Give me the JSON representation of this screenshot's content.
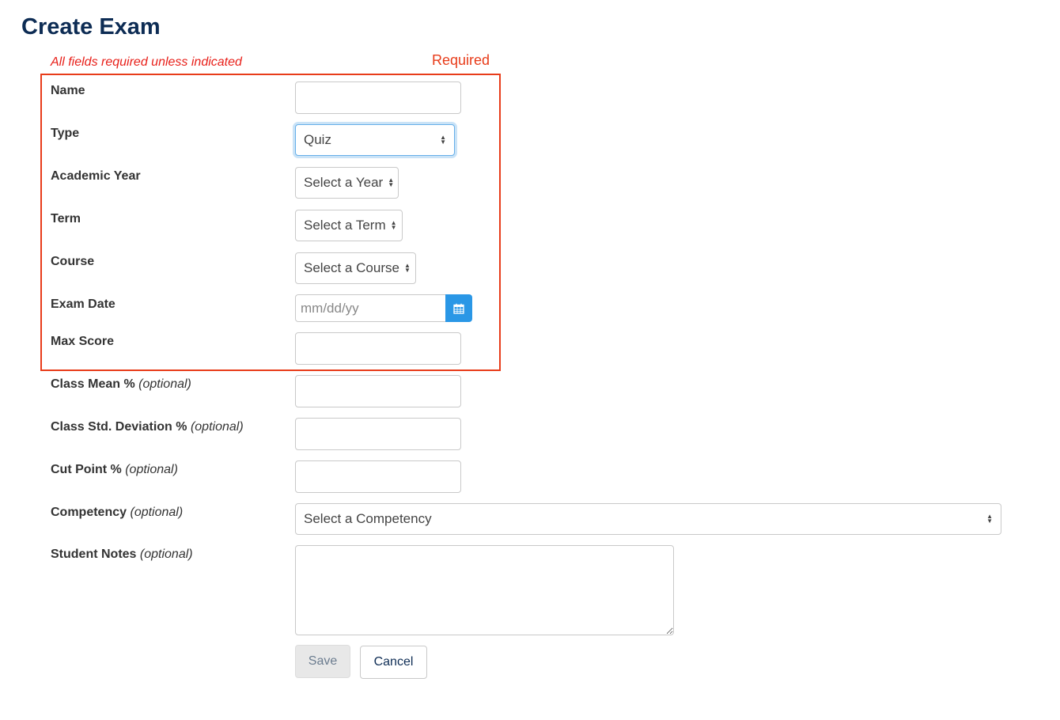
{
  "page": {
    "title": "Create Exam",
    "required_note": "All fields required unless indicated",
    "required_legend": "Required"
  },
  "form": {
    "optional_tag": "(optional)",
    "name": {
      "label": "Name",
      "value": ""
    },
    "type": {
      "label": "Type",
      "selected": "Quiz"
    },
    "academic_year": {
      "label": "Academic Year",
      "selected": "Select a Year"
    },
    "term": {
      "label": "Term",
      "selected": "Select a Term"
    },
    "course": {
      "label": "Course",
      "selected": "Select a Course"
    },
    "exam_date": {
      "label": "Exam Date",
      "placeholder": "mm/dd/yy",
      "button_icon": "calendar-icon"
    },
    "max_score": {
      "label": "Max Score",
      "value": ""
    },
    "class_mean": {
      "label": "Class Mean %",
      "value": ""
    },
    "class_std_dev": {
      "label": "Class Std. Deviation %",
      "value": ""
    },
    "cut_point": {
      "label": "Cut Point %",
      "value": ""
    },
    "competency": {
      "label": "Competency",
      "selected": "Select a Competency"
    },
    "student_notes": {
      "label": "Student Notes",
      "value": ""
    }
  },
  "actions": {
    "save_label": "Save",
    "cancel_label": "Cancel"
  },
  "colors": {
    "title": "#0d2c54",
    "required": "#e83c1a",
    "calendar_button": "#2a97e6",
    "focus": "#66afe9"
  }
}
